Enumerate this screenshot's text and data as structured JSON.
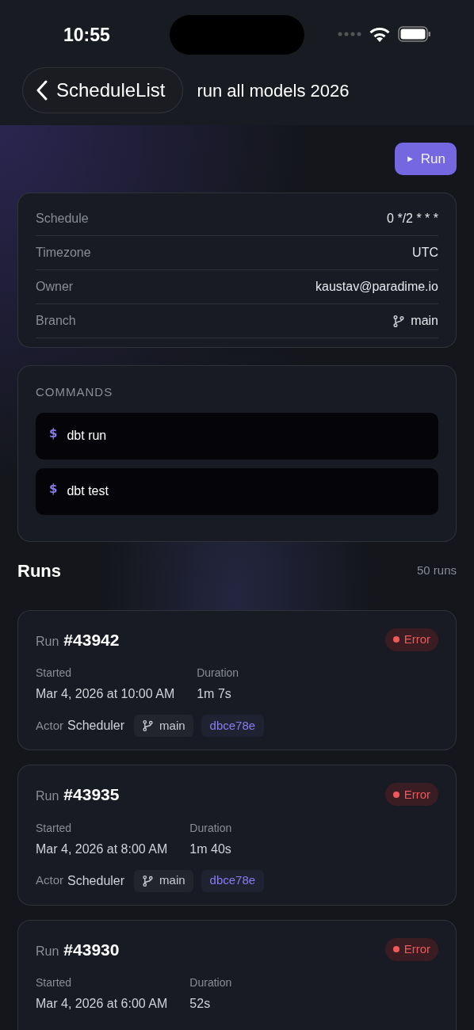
{
  "status_bar": {
    "time": "10:55"
  },
  "header": {
    "back_label": "ScheduleList",
    "title": "run all models 2026"
  },
  "run_button": {
    "icon": "►",
    "label": "Run"
  },
  "details": [
    {
      "label": "Schedule",
      "value": "0 */2 * * *",
      "kind": "text"
    },
    {
      "label": "Timezone",
      "value": "UTC",
      "kind": "text"
    },
    {
      "label": "Owner",
      "value": "kaustav@paradime.io",
      "kind": "text"
    },
    {
      "label": "Branch",
      "value": "main",
      "kind": "branch"
    }
  ],
  "commands": {
    "heading": "COMMANDS",
    "items": [
      {
        "prompt": "$",
        "command": "dbt run"
      },
      {
        "prompt": "$",
        "command": "dbt test"
      }
    ]
  },
  "runs": {
    "heading": "Runs",
    "count": "50 runs",
    "items": [
      {
        "prefix": "Run",
        "number": "#43942",
        "status": "Error",
        "started_label": "Started",
        "started": "Mar 4, 2026 at 10:00 AM",
        "duration_label": "Duration",
        "duration": "1m 7s",
        "actor_label": "Actor",
        "actor": "Scheduler",
        "branch": "main",
        "commit": "dbce78e"
      },
      {
        "prefix": "Run",
        "number": "#43935",
        "status": "Error",
        "started_label": "Started",
        "started": "Mar 4, 2026 at 8:00 AM",
        "duration_label": "Duration",
        "duration": "1m 40s",
        "actor_label": "Actor",
        "actor": "Scheduler",
        "branch": "main",
        "commit": "dbce78e"
      },
      {
        "prefix": "Run",
        "number": "#43930",
        "status": "Error",
        "started_label": "Started",
        "started": "Mar 4, 2026 at 6:00 AM",
        "duration_label": "Duration",
        "duration": "52s"
      }
    ]
  }
}
